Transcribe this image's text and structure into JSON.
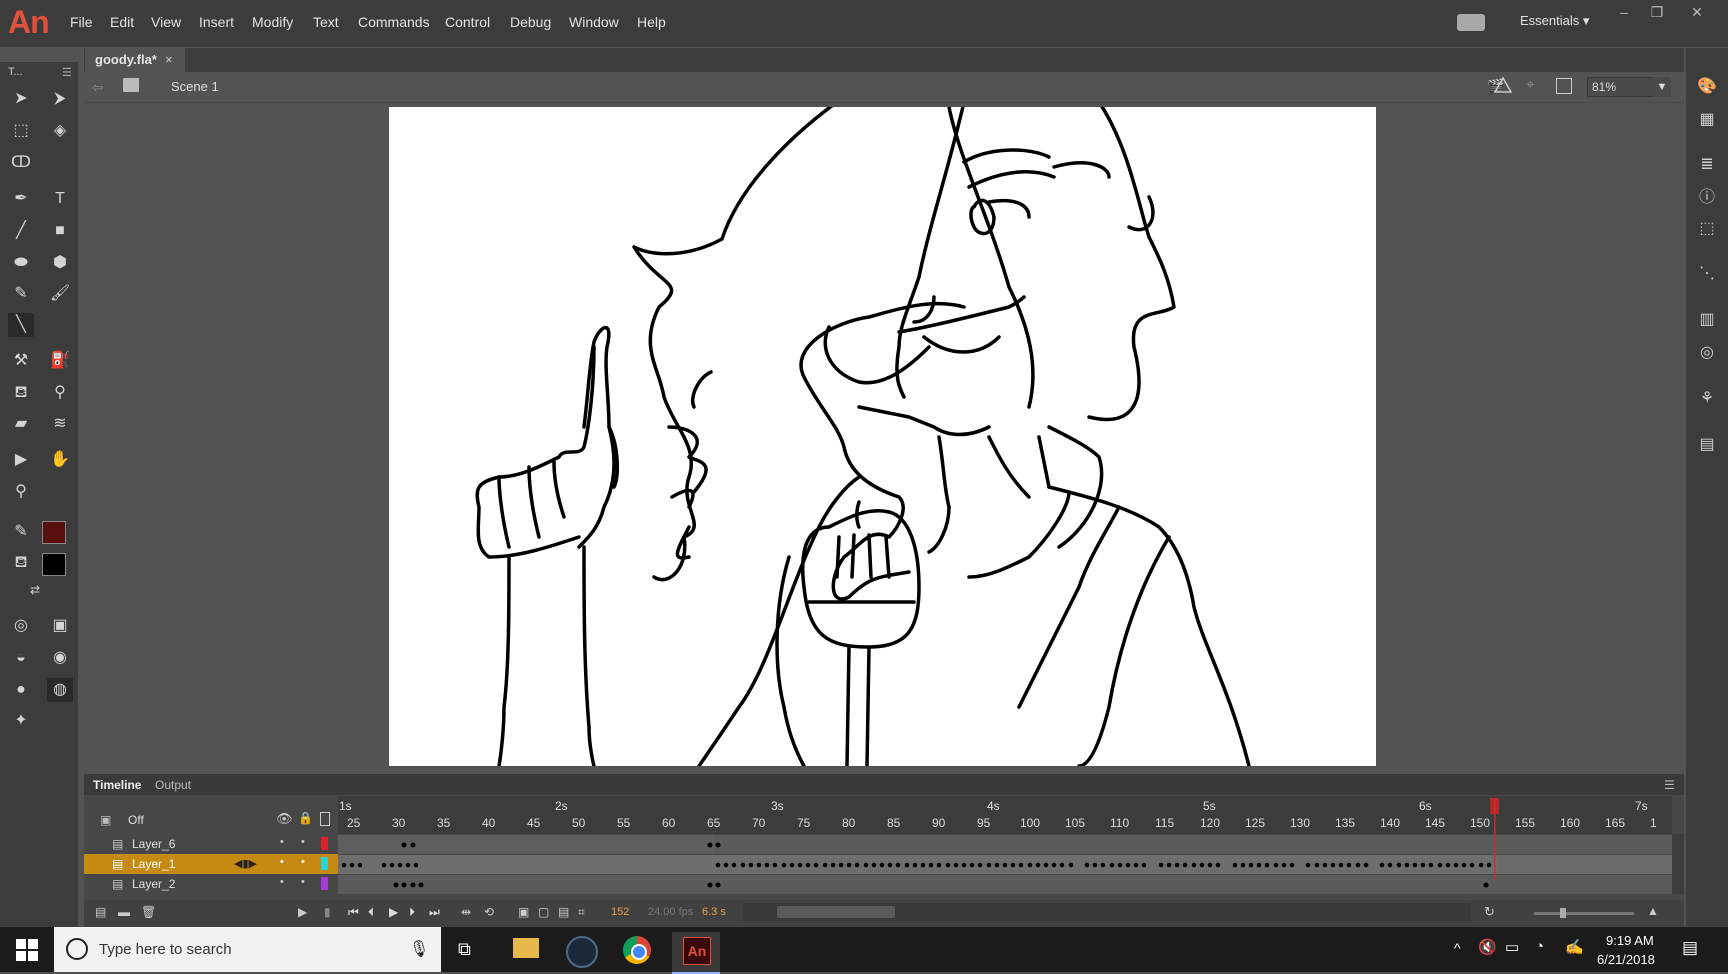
{
  "app": {
    "logo": "An",
    "menu": [
      "File",
      "Edit",
      "View",
      "Insert",
      "Modify",
      "Text",
      "Commands",
      "Control",
      "Debug",
      "Window",
      "Help"
    ],
    "workspace": "Essentials"
  },
  "document": {
    "tab_title": "goody.fla*",
    "scene": "Scene 1",
    "zoom": "81%"
  },
  "colors": {
    "stroke_color": "#5a0f0f",
    "fill_color": "#000000"
  },
  "timeline": {
    "tabs": [
      "Timeline",
      "Output"
    ],
    "onion": "Off",
    "seconds": [
      "1s",
      "2s",
      "3s",
      "4s",
      "5s",
      "6s",
      "7s"
    ],
    "frame_numbers": [
      "25",
      "30",
      "35",
      "40",
      "45",
      "50",
      "55",
      "60",
      "65",
      "70",
      "75",
      "80",
      "85",
      "90",
      "95",
      "100",
      "105",
      "110",
      "115",
      "120",
      "125",
      "130",
      "135",
      "140",
      "145",
      "150",
      "155",
      "160",
      "165",
      "1"
    ],
    "layers": [
      {
        "name": "Layer_6",
        "color": "#e0202a",
        "selected": false
      },
      {
        "name": "Layer_1",
        "color": "#29d4d4",
        "selected": true
      },
      {
        "name": "Layer_2",
        "color": "#a63ad6",
        "selected": false
      }
    ],
    "current_frame": "152",
    "fps": "24.00 fps",
    "elapsed": "6.3 s"
  },
  "taskbar": {
    "search_placeholder": "Type here to search",
    "time": "9:19 AM",
    "date": "6/21/2018"
  }
}
